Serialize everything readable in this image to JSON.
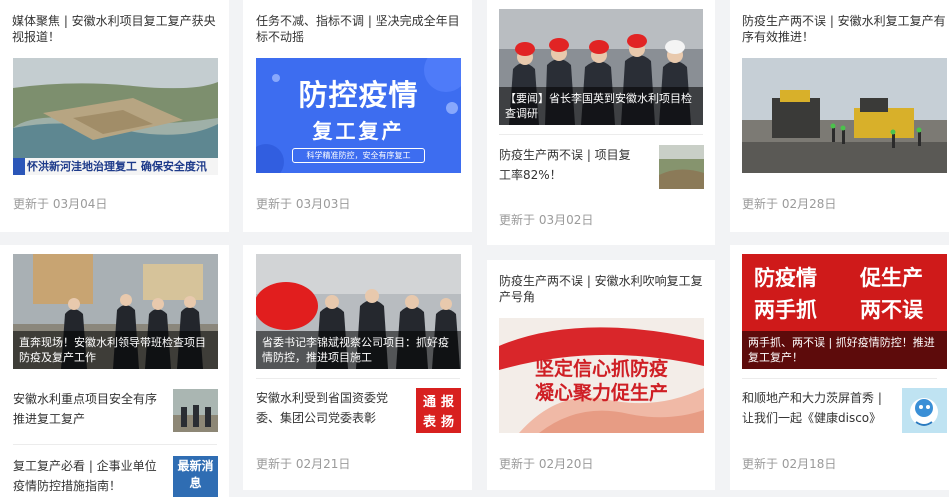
{
  "cards": [
    {
      "title": "媒体聚焦 | 安徽水利项目复工复产获央视报道！",
      "image_overlay": "怀洪新河洼地治理复工 确保安全度汛",
      "updated": "更新于 03月04日"
    },
    {
      "title": "任务不减、指标不调 | 坚决完成全年目标不动摇",
      "poster": {
        "main": "防控疫情",
        "sub": "复工复产",
        "tag": "科学精准防控，安全有序复工"
      },
      "updated": "更新于 03月03日"
    },
    {
      "image_caption": "【要闻】省长李国英到安徽水利项目检查调研",
      "sub_item": "防疫生产两不误 | 项目复工率82%！",
      "updated": "更新于 03月02日"
    },
    {
      "title": "防疫生产两不误 | 安徽水利复工复产有序有效推进！",
      "updated": "更新于 02月28日"
    },
    {
      "image_caption": "直奔现场！安徽水利领导带班检查项目防疫及复产工作",
      "sub_items": [
        "安徽水利重点项目安全有序推进复工复产",
        "复工复产必看 | 企事业单位疫情防控措施指南！"
      ],
      "thumb_badge": "最新消息"
    },
    {
      "image_caption": "省委书记李锦斌视察公司项目：抓好疫情防控，推进项目施工",
      "sub_item": "安徽水利受到省国资委党委、集团公司党委表彰",
      "thumb_badge": [
        "通",
        "报",
        "表",
        "扬"
      ],
      "updated": "更新于 02月21日"
    },
    {
      "title": "防疫生产两不误 | 安徽水利吹响复工复产号角",
      "poster": {
        "line1": "坚定信心抓防疫",
        "line2": "凝心聚力促生产"
      },
      "updated": "更新于 02月20日"
    },
    {
      "poster": {
        "a": "防疫情",
        "b": "促生产",
        "c": "两手抓",
        "d": "两不误"
      },
      "image_caption": "两手抓、两不误 | 抓好疫情防控！推进复工复产！",
      "sub_item": "和顺地产和大力茨屏首秀 | 让我们一起《健康disco》",
      "updated": "更新于 02月18日"
    }
  ],
  "colors": {
    "accent_red": "#c8161d",
    "poster_blue": "#3d6df0",
    "muted": "#9a9a9a"
  }
}
